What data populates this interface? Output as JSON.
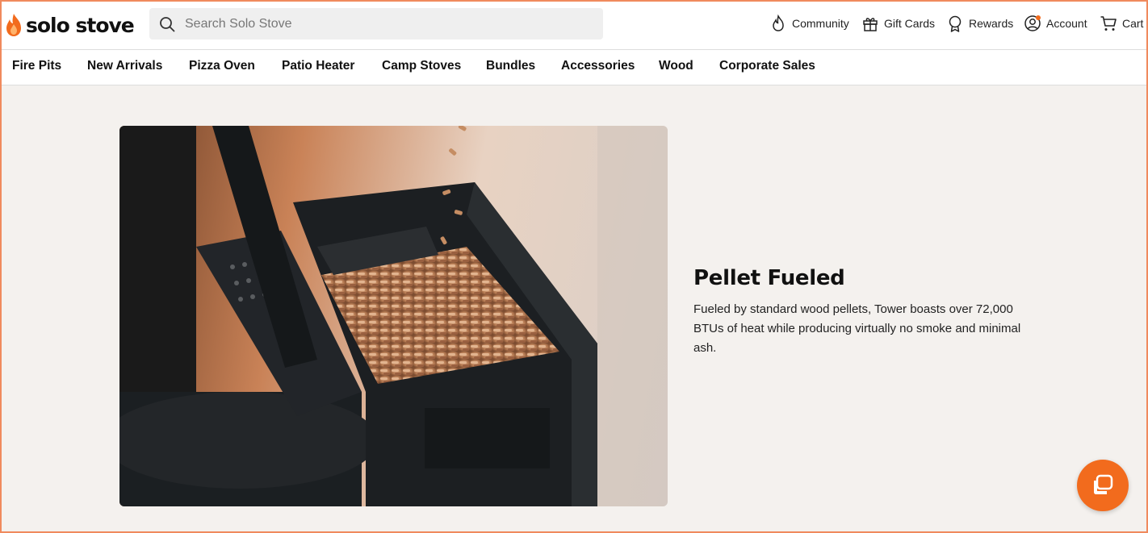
{
  "header": {
    "logo_text": "solo stove",
    "search_placeholder": "Search Solo Stove",
    "links": [
      {
        "label": "Community",
        "icon": "flame-outline-icon"
      },
      {
        "label": "Gift Cards",
        "icon": "gift-icon"
      },
      {
        "label": "Rewards",
        "icon": "ribbon-icon"
      },
      {
        "label": "Account",
        "icon": "user-circle-icon"
      },
      {
        "label": "Cart",
        "icon": "cart-icon"
      }
    ]
  },
  "nav": {
    "items": [
      "Fire Pits",
      "New Arrivals",
      "Pizza Oven",
      "Patio Heater",
      "Camp Stoves",
      "Bundles",
      "Accessories",
      "Wood",
      "Corporate Sales"
    ]
  },
  "feature": {
    "title": "Pellet Fueled",
    "body": "Fueled by standard wood pellets, Tower boasts over 72,000 BTUs of heat while producing virtually no smoke and minimal ash.",
    "image": "pellet-hopper-photo"
  },
  "chat": {
    "icon": "chat-icon"
  },
  "colors": {
    "accent": "#f26b1d",
    "page_bg": "#f4f1ee",
    "frame": "#f08a5d"
  }
}
